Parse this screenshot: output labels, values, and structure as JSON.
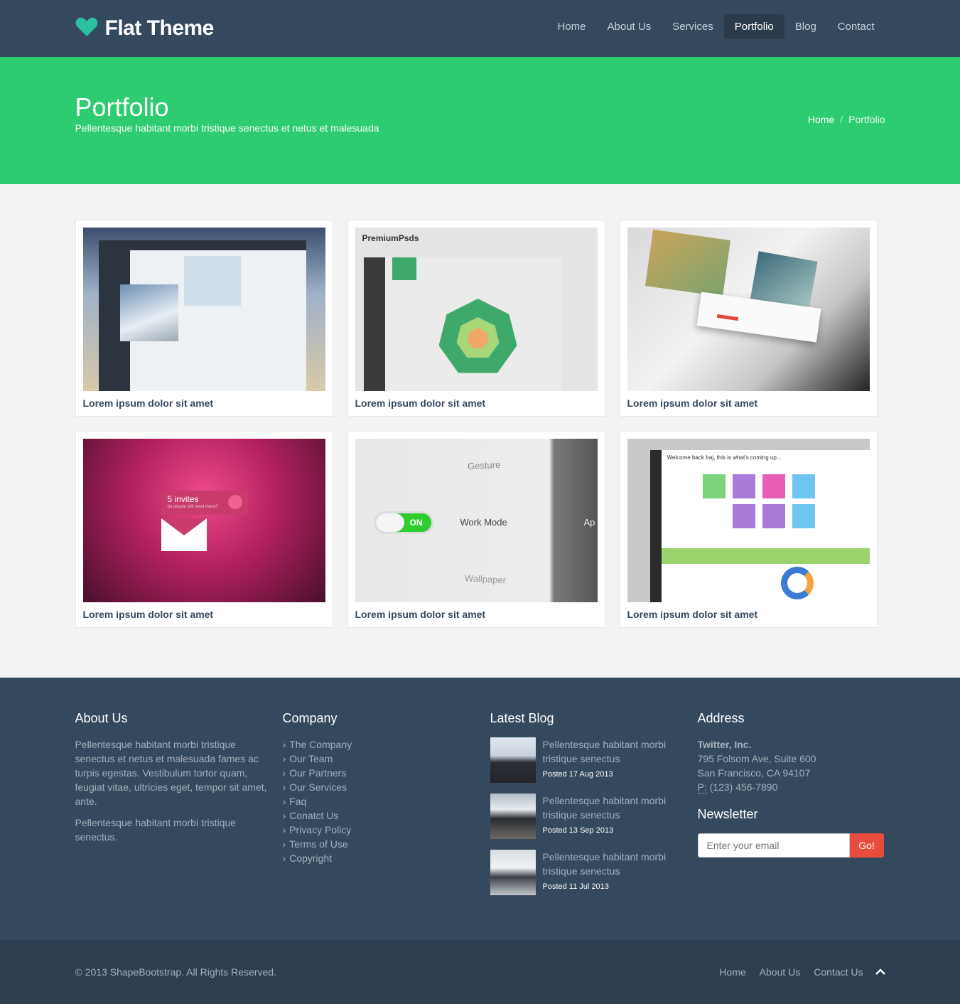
{
  "brand": {
    "name": "Flat Theme",
    "icon": "heart-icon",
    "icon_color": "#2bc0a0"
  },
  "nav": [
    {
      "label": "Home",
      "active": false
    },
    {
      "label": "About Us",
      "active": false
    },
    {
      "label": "Services",
      "active": false
    },
    {
      "label": "Portfolio",
      "active": true
    },
    {
      "label": "Blog",
      "active": false
    },
    {
      "label": "Contact",
      "active": false
    }
  ],
  "page": {
    "title": "Portfolio",
    "subtitle": "Pellentesque habitant morbi tristique senectus et netus et malesuada",
    "breadcrumb": {
      "home": "Home",
      "separator": "/",
      "current": "Portfolio"
    }
  },
  "portfolio": {
    "items": [
      {
        "title": "Lorem ipsum dolor sit amet"
      },
      {
        "title": "Lorem ipsum dolor sit amet",
        "thumb_text": "PremiumPsds"
      },
      {
        "title": "Lorem ipsum dolor sit amet"
      },
      {
        "title": "Lorem ipsum dolor sit amet",
        "thumb_text": "5 invites",
        "thumb_sub": "do people still need these?"
      },
      {
        "title": "Lorem ipsum dolor sit amet",
        "thumb_text": "Work Mode",
        "toggle": "ON",
        "top": "Gesture",
        "bottom": "Wallpaper",
        "right": "Ap"
      },
      {
        "title": "Lorem ipsum dolor sit amet",
        "thumb_text": "Welcome back Iraj, this is what's coming up..."
      }
    ]
  },
  "footer": {
    "about": {
      "heading": "About Us",
      "p1": "Pellentesque habitant morbi tristique senectus et netus et malesuada fames ac turpis egestas. Vestibulum tortor quam, feugiat vitae, ultricies eget, tempor sit amet, ante.",
      "p2": "Pellentesque habitant morbi tristique senectus."
    },
    "company": {
      "heading": "Company",
      "links": [
        "The Company",
        "Our Team",
        "Our Partners",
        "Our Services",
        "Faq",
        "Conatct Us",
        "Privacy Policy",
        "Terms of Use",
        "Copyright"
      ]
    },
    "blog": {
      "heading": "Latest Blog",
      "posts": [
        {
          "text": "Pellentesque habitant morbi tristique senectus",
          "date": "Posted 17 Aug 2013"
        },
        {
          "text": "Pellentesque habitant morbi tristique senectus",
          "date": "Posted 13 Sep 2013"
        },
        {
          "text": "Pellentesque habitant morbi tristique senectus",
          "date": "Posted 11 Jul 2013"
        }
      ]
    },
    "address": {
      "heading": "Address",
      "company": "Twitter, Inc.",
      "line1": "795 Folsom Ave, Suite 600",
      "line2": "San Francisco, CA 94107",
      "phone_label": "P:",
      "phone": "(123) 456-7890"
    },
    "newsletter": {
      "heading": "Newsletter",
      "placeholder": "Enter your email",
      "button": "Go!"
    }
  },
  "bottom": {
    "copyright": "© 2013 ShapeBootstrap. All Rights Reserved.",
    "links": [
      "Home",
      "About Us",
      "Contact Us"
    ],
    "up_icon": "chevron-up-icon"
  },
  "colors": {
    "header": "#34495e",
    "accent": "#2ecc71",
    "footer": "#34495e",
    "bottom": "#2c3e50",
    "button": "#e74c3c"
  }
}
